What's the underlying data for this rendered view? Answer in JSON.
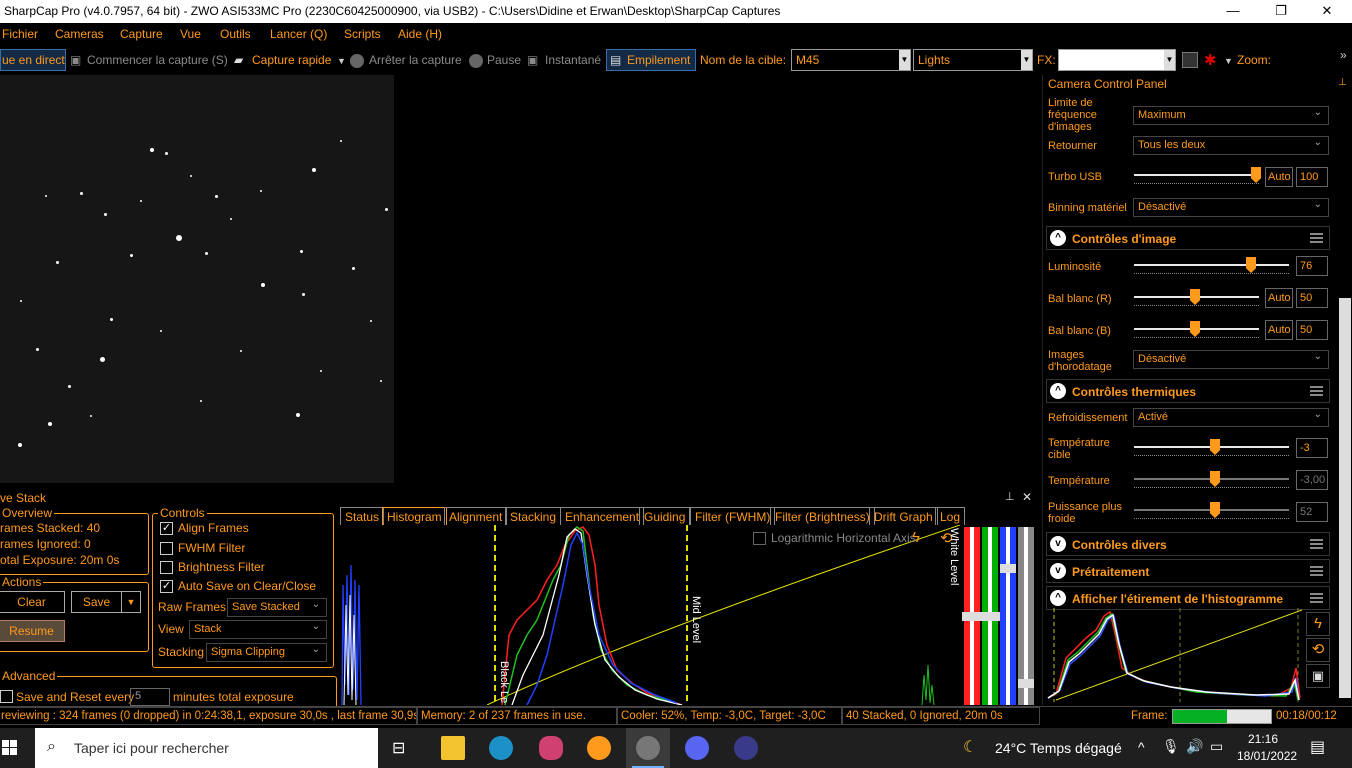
{
  "window": {
    "title": "SharpCap Pro (v4.0.7957, 64 bit) - ZWO ASI533MC Pro (2230C60425000900, via USB2) - C:\\Users\\Didine et Erwan\\Desktop\\SharpCap Captures",
    "min": "—",
    "max": "❐",
    "close": "✕"
  },
  "menu": [
    "Fichier",
    "Cameras",
    "Capture",
    "Vue",
    "Outils",
    "Lancer (Q)",
    "Scripts",
    "Aide (H)"
  ],
  "toolbar": {
    "live": "ue en direct",
    "start_capture": "Commencer la capture (S)",
    "quick_capture": "Capture rapide",
    "stop_capture": "Arrêter la capture",
    "pause": "Pause",
    "snapshot": "Instantané",
    "stacking": "Empilement",
    "target_label": "Nom de la cible:",
    "target_value": "M45",
    "frame_type": "Lights",
    "fx_label": "FX:",
    "zoom_label": "Zoom:"
  },
  "camera_panel": {
    "title": "Camera Control Panel",
    "frame_rate_label": "Limite de fréquence d'images",
    "frame_rate_value": "Maximum",
    "flip_label": "Retourner",
    "flip_value": "Tous les deux",
    "turbo_label": "Turbo USB",
    "turbo_auto": "Auto",
    "turbo_value": "100",
    "binning_label": "Binning matériel",
    "binning_value": "Désactivé",
    "image_controls": "Contrôles d'image",
    "brightness_label": "Luminosité",
    "brightness_value": "76",
    "wb_r_label": "Bal blanc (R)",
    "wb_r_auto": "Auto",
    "wb_r_value": "50",
    "wb_b_label": "Bal blanc (B)",
    "wb_b_auto": "Auto",
    "wb_b_value": "50",
    "timestamp_label": "Images d'horodatage",
    "timestamp_value": "Désactivé",
    "thermal_controls": "Contrôles thermiques",
    "cooling_label": "Refroidissement",
    "cooling_value": "Activé",
    "target_temp_label": "Température cible",
    "target_temp_value": "-3",
    "temp_label": "Température",
    "temp_value": "-3,00",
    "power_label": "Puissance plus froide",
    "power_value": "52",
    "misc_controls": "Contrôles divers",
    "preprocessing": "Prétraitement",
    "histogram_stretch": "Afficher l'étirement de l'histogramme"
  },
  "stack": {
    "title": "ve Stack",
    "overview": "Overview",
    "frames_stacked": "rames Stacked: 40",
    "frames_ignored": "rames Ignored:  0",
    "total_exposure": "otal Exposure:   20m 0s",
    "actions": "Actions",
    "clear": "Clear",
    "save": "Save",
    "resume": "Resume",
    "advanced": "Advanced",
    "save_reset_label": "Save and Reset every",
    "save_reset_value": "5",
    "save_reset_suffix": "minutes total exposure",
    "controls": "Controls",
    "align_frames": "Align Frames",
    "fwhm_filter": "FWHM Filter",
    "brightness_filter": "Brightness Filter",
    "auto_save": "Auto Save on Clear/Close",
    "raw_frames_label": "Raw Frames",
    "raw_frames_value": "Save Stacked",
    "view_label": "View",
    "view_value": "Stack",
    "stacking_label": "Stacking",
    "stacking_value": "Sigma Clipping"
  },
  "tabs": [
    "Status",
    "Histogram",
    "Alignment",
    "Stacking",
    "Enhancement",
    "Guiding",
    "Filter (FWHM)",
    "Filter (Brightness)",
    "Drift Graph",
    "Log"
  ],
  "histogram": {
    "log_axis": "Logarithmic Horizontal Axis",
    "black_level": "Black Le",
    "mid_level": "Mid Level",
    "white_level": "White Level"
  },
  "status": {
    "previewing": "reviewing : 324 frames (0 dropped) in 0:24:38,1, exposure 30,0s , last frame 30,9s",
    "memory": "Memory: 2 of 237 frames in use.",
    "cooler": "Cooler: 52%, Temp: -3,0C, Target: -3,0C",
    "stacked": "40 Stacked, 0 Ignored, 20m 0s",
    "frame_label": "Frame:",
    "time": "00:18/00:12",
    "frame_progress": 0.55
  },
  "taskbar": {
    "search_placeholder": "Taper ici pour rechercher",
    "weather": "24°C  Temps dégagé",
    "clock_time": "21:16",
    "clock_date": "18/01/2022",
    "lang_icon": "^"
  },
  "colors": {
    "accent": "#ff9a1c",
    "red": "#ff2020",
    "green": "#00c000",
    "blue": "#2040ff",
    "curve": "#e0e000"
  }
}
